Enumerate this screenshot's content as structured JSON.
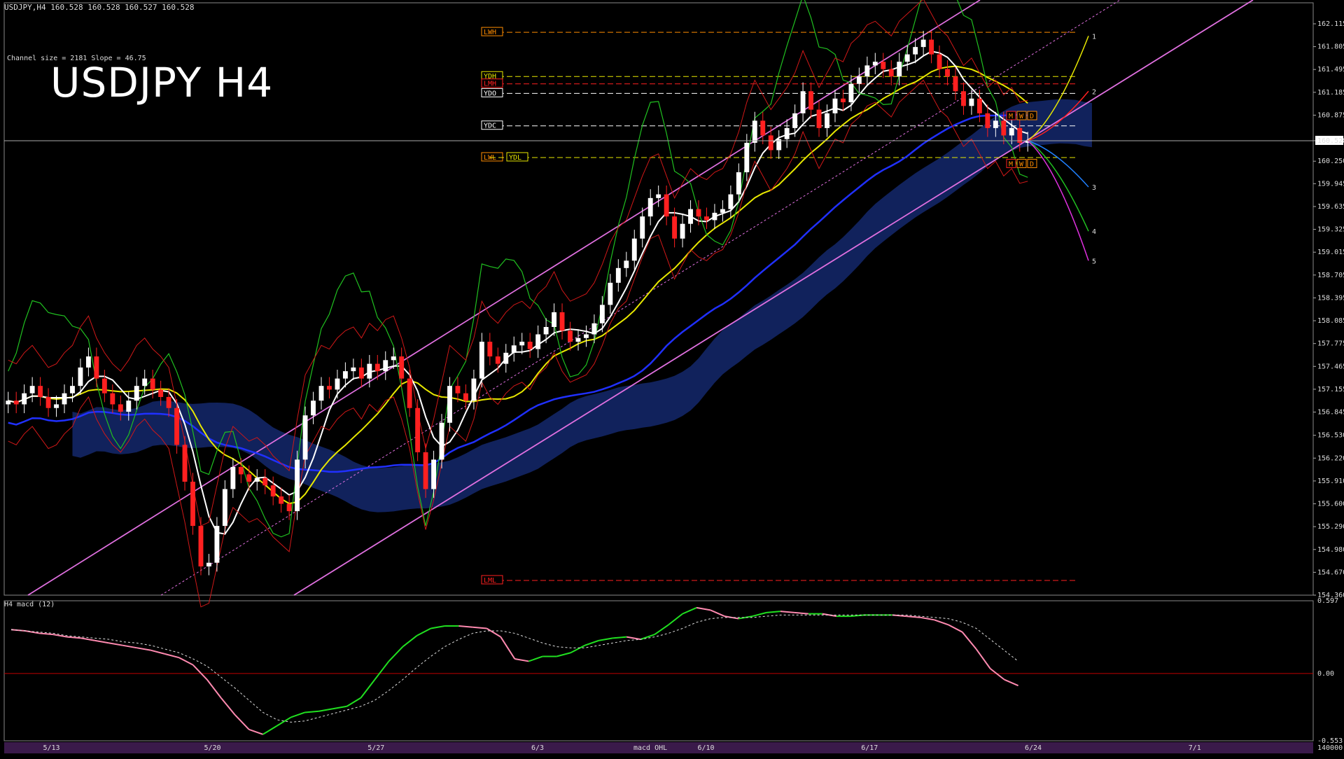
{
  "header": {
    "symbol_line": "USDJPY,H4  160.528 160.528 160.527 160.528",
    "channel_info": "Channel size = 2181 Slope = 46.75",
    "title": "USDJPY H4",
    "macd_label": "H4  macd (12)"
  },
  "colors": {
    "bull": "#ffffff",
    "bear": "#ff2020",
    "channel": "#e070e0",
    "fast_ma": "#ffffff",
    "slow_ma": "#e8e800",
    "blue_ma": "#2030ff",
    "cloud": "#1f3ea8",
    "green_line": "#20c020",
    "macd_up": "#20e020",
    "macd_down": "#ff8ab0"
  },
  "chart_data": [
    {
      "type": "line",
      "title": "USDJPY H4",
      "ylim": [
        154.36,
        162.4
      ],
      "xlabel": "",
      "ylabel": "",
      "price_ticks": [
        "162.115",
        "161.805",
        "161.495",
        "161.185",
        "160.875",
        "160.528",
        "160.250",
        "159.945",
        "159.635",
        "159.325",
        "159.015",
        "158.705",
        "158.395",
        "158.085",
        "157.775",
        "157.465",
        "157.155",
        "156.845",
        "156.530",
        "156.220",
        "155.910",
        "155.600",
        "155.290",
        "154.980",
        "154.670",
        "154.360"
      ],
      "current_price": "160.528",
      "date_ticks": [
        {
          "label": "5/13",
          "pos": 0.035
        },
        {
          "label": "5/20",
          "pos": 0.158
        },
        {
          "label": "5/27",
          "pos": 0.283
        },
        {
          "label": "6/3",
          "pos": 0.408
        },
        {
          "label": "6/10",
          "pos": 0.535
        },
        {
          "label": "6/17",
          "pos": 0.66
        },
        {
          "label": "6/24",
          "pos": 0.785
        },
        {
          "label": "7/1",
          "pos": 0.91
        }
      ],
      "close_series": [
        157.0,
        156.95,
        157.1,
        157.2,
        157.05,
        156.9,
        156.95,
        157.1,
        157.2,
        157.45,
        157.6,
        157.3,
        157.1,
        156.95,
        156.85,
        157.0,
        157.2,
        157.3,
        157.15,
        157.05,
        156.9,
        156.4,
        155.9,
        155.3,
        154.75,
        154.8,
        155.3,
        155.8,
        156.1,
        156.0,
        155.9,
        155.95,
        155.85,
        155.7,
        155.6,
        155.5,
        156.2,
        156.8,
        157.0,
        157.2,
        157.15,
        157.3,
        157.4,
        157.45,
        157.3,
        157.5,
        157.4,
        157.55,
        157.6,
        157.3,
        156.9,
        156.3,
        155.8,
        156.2,
        156.7,
        157.2,
        157.1,
        157.0,
        157.3,
        157.8,
        157.6,
        157.5,
        157.65,
        157.75,
        157.8,
        157.7,
        157.9,
        158.0,
        158.2,
        157.95,
        157.8,
        157.85,
        157.9,
        158.05,
        158.3,
        158.6,
        158.8,
        158.9,
        159.2,
        159.5,
        159.75,
        159.8,
        159.5,
        159.2,
        159.4,
        159.6,
        159.5,
        159.45,
        159.55,
        159.6,
        159.8,
        160.1,
        160.5,
        160.8,
        160.6,
        160.4,
        160.55,
        160.7,
        160.9,
        161.2,
        160.95,
        160.7,
        160.9,
        161.1,
        161.05,
        161.3,
        161.4,
        161.55,
        161.6,
        161.5,
        161.4,
        161.6,
        161.7,
        161.8,
        161.9,
        161.7,
        161.5,
        161.4,
        161.2,
        161.0,
        161.1,
        160.9,
        160.7,
        160.8,
        160.6,
        160.7,
        160.5,
        160.528
      ],
      "levels": [
        {
          "label": "LWH",
          "value": 162.0
        },
        {
          "label": "YDH",
          "value": 161.4
        },
        {
          "label": "LMH",
          "value": 161.3
        },
        {
          "label": "YDO",
          "value": 161.17
        },
        {
          "label": "YDC",
          "value": 160.73
        },
        {
          "label": "LWL",
          "value": 160.3
        },
        {
          "label": "YDL",
          "value": 160.3
        },
        {
          "label": "LML",
          "value": 154.56
        }
      ],
      "projection_labels": [
        "1",
        "2",
        "3",
        "4",
        "5"
      ],
      "right_tags": [
        "M",
        "W",
        "D",
        "M",
        "W",
        "D"
      ]
    },
    {
      "type": "line",
      "title": "H4  macd (12)",
      "ylim": [
        -0.553,
        0.597
      ],
      "ticks": [
        "0.597",
        "0.00",
        "-0.553"
      ],
      "bottom_readout": "140000",
      "overlay_text": "macd OHL",
      "macd": [
        0.36,
        0.35,
        0.33,
        0.32,
        0.3,
        0.29,
        0.27,
        0.25,
        0.23,
        0.21,
        0.19,
        0.16,
        0.13,
        0.07,
        -0.05,
        -0.2,
        -0.34,
        -0.46,
        -0.5,
        -0.43,
        -0.36,
        -0.32,
        -0.31,
        -0.29,
        -0.27,
        -0.2,
        -0.05,
        0.1,
        0.22,
        0.31,
        0.37,
        0.39,
        0.39,
        0.38,
        0.37,
        0.3,
        0.12,
        0.1,
        0.14,
        0.14,
        0.17,
        0.23,
        0.27,
        0.29,
        0.3,
        0.28,
        0.32,
        0.4,
        0.49,
        0.54,
        0.52,
        0.47,
        0.45,
        0.47,
        0.5,
        0.51,
        0.5,
        0.49,
        0.49,
        0.47,
        0.47,
        0.48,
        0.48,
        0.48,
        0.47,
        0.46,
        0.44,
        0.4,
        0.34,
        0.2,
        0.04,
        -0.05,
        -0.1
      ],
      "signal": [
        0.36,
        0.35,
        0.34,
        0.33,
        0.31,
        0.3,
        0.29,
        0.28,
        0.26,
        0.25,
        0.23,
        0.2,
        0.17,
        0.12,
        0.06,
        -0.03,
        -0.12,
        -0.22,
        -0.32,
        -0.38,
        -0.4,
        -0.39,
        -0.36,
        -0.33,
        -0.3,
        -0.27,
        -0.22,
        -0.14,
        -0.05,
        0.05,
        0.14,
        0.22,
        0.28,
        0.33,
        0.35,
        0.35,
        0.33,
        0.29,
        0.25,
        0.22,
        0.21,
        0.21,
        0.23,
        0.25,
        0.27,
        0.28,
        0.3,
        0.33,
        0.37,
        0.42,
        0.45,
        0.46,
        0.46,
        0.46,
        0.47,
        0.48,
        0.48,
        0.48,
        0.48,
        0.48,
        0.48,
        0.48,
        0.48,
        0.48,
        0.48,
        0.47,
        0.46,
        0.45,
        0.42,
        0.37,
        0.28,
        0.19,
        0.1
      ]
    }
  ]
}
